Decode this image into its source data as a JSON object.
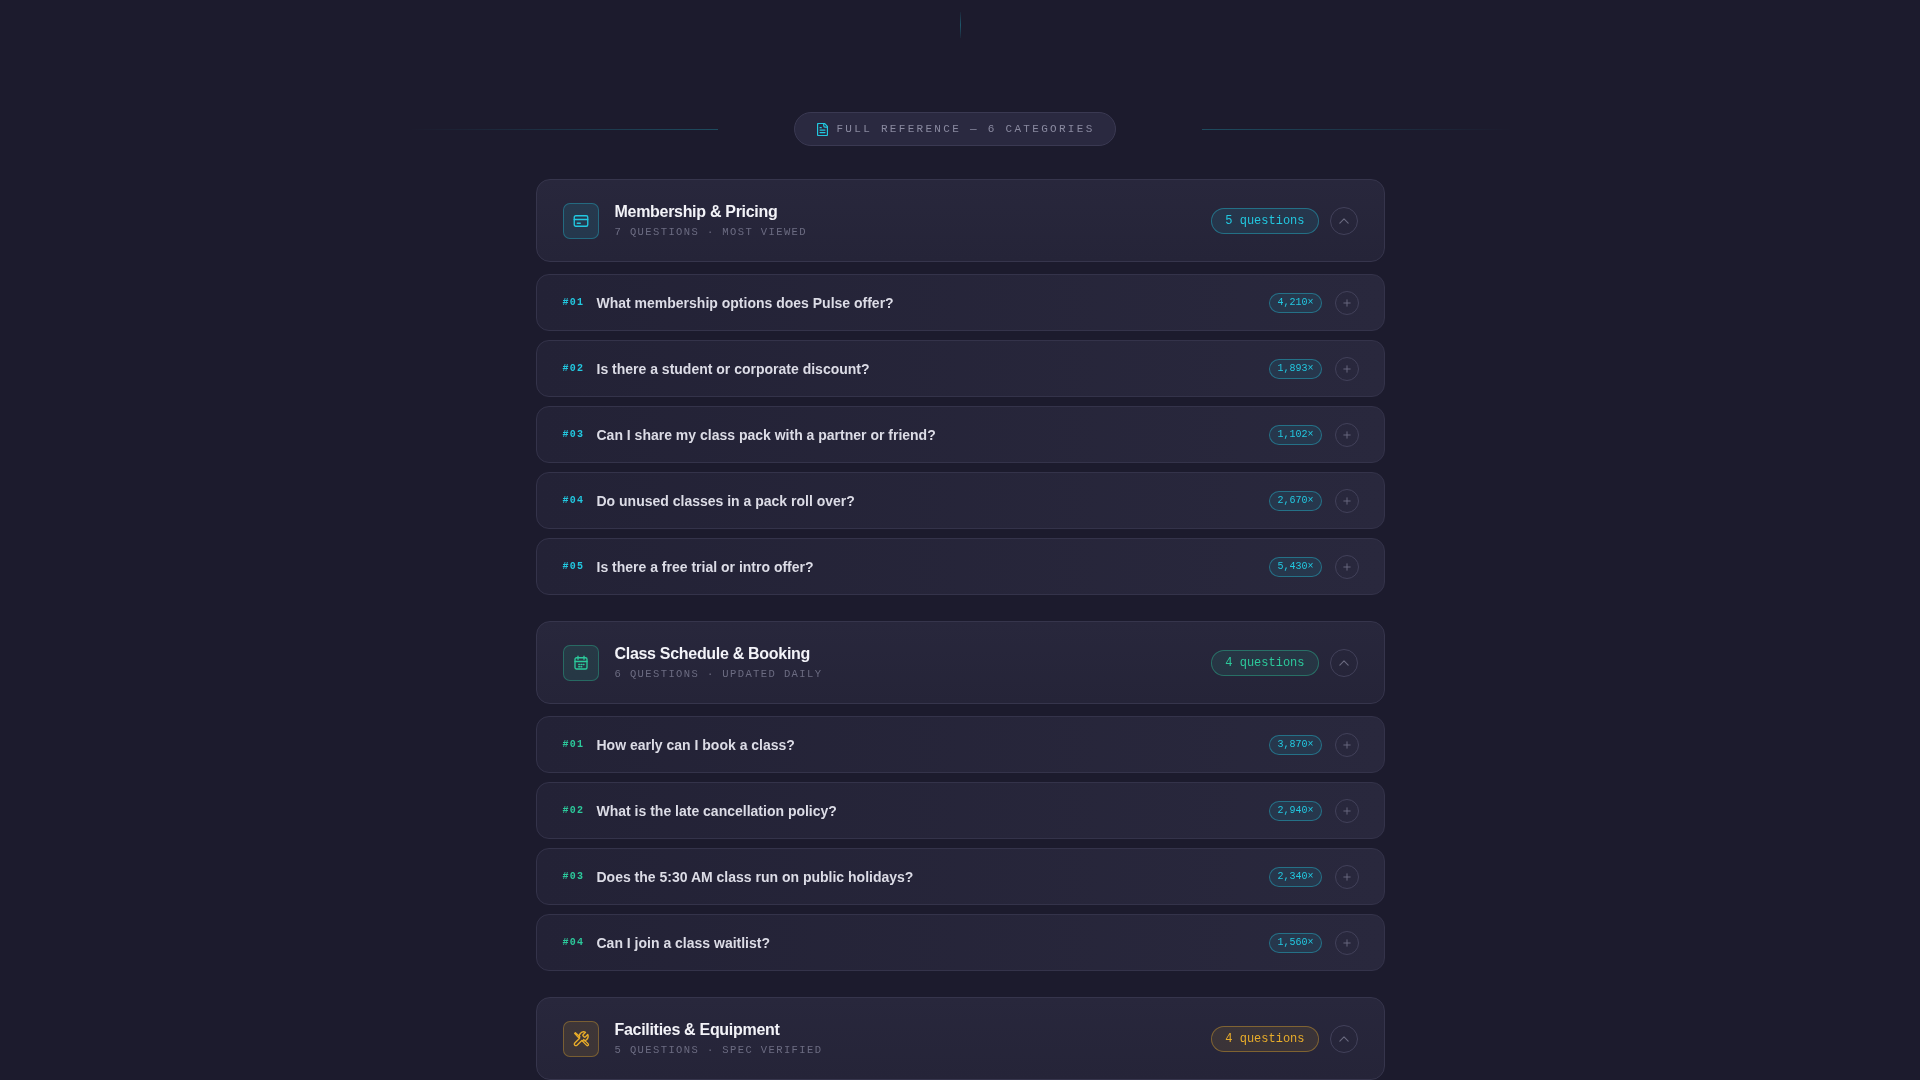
{
  "banner": {
    "label": "FULL REFERENCE — 6 CATEGORIES"
  },
  "groups": [
    {
      "title": "Membership & Pricing",
      "meta": "7 QUESTIONS · MOST VIEWED",
      "count_badge": "5 questions",
      "color": "#22c8e0",
      "expanded": true,
      "questions": [
        {
          "number": "#01",
          "text": "What membership options does Pulse offer?",
          "views": "4,210×",
          "expanded": false
        },
        {
          "number": "#02",
          "text": "Is there a student or corporate discount?",
          "views": "1,893×",
          "expanded": false
        },
        {
          "number": "#03",
          "text": "Can I share my class pack with a partner or friend?",
          "views": "1,102×",
          "expanded": false
        },
        {
          "number": "#04",
          "text": "Do unused classes in a pack roll over?",
          "views": "2,670×",
          "expanded": false
        },
        {
          "number": "#05",
          "text": "Is there a free trial or intro offer?",
          "views": "5,430×",
          "expanded": false
        }
      ]
    },
    {
      "title": "Class Schedule & Booking",
      "meta": "6 QUESTIONS · UPDATED DAILY",
      "count_badge": "4 questions",
      "color": "#2cc99b",
      "expanded": true,
      "questions": [
        {
          "number": "#01",
          "text": "How early can I book a class?",
          "views": "3,870×",
          "expanded": false
        },
        {
          "number": "#02",
          "text": "What is the late cancellation policy?",
          "views": "2,940×",
          "expanded": false
        },
        {
          "number": "#03",
          "text": "Does the 5:30 AM class run on public holidays?",
          "views": "2,340×",
          "expanded": false
        },
        {
          "number": "#04",
          "text": "Can I join a class waitlist?",
          "views": "1,560×",
          "expanded": false
        }
      ]
    },
    {
      "title": "Facilities & Equipment",
      "meta": "5 QUESTIONS · SPEC VERIFIED",
      "count_badge": "4 questions",
      "color": "#e9ad2a",
      "expanded": true
    }
  ]
}
